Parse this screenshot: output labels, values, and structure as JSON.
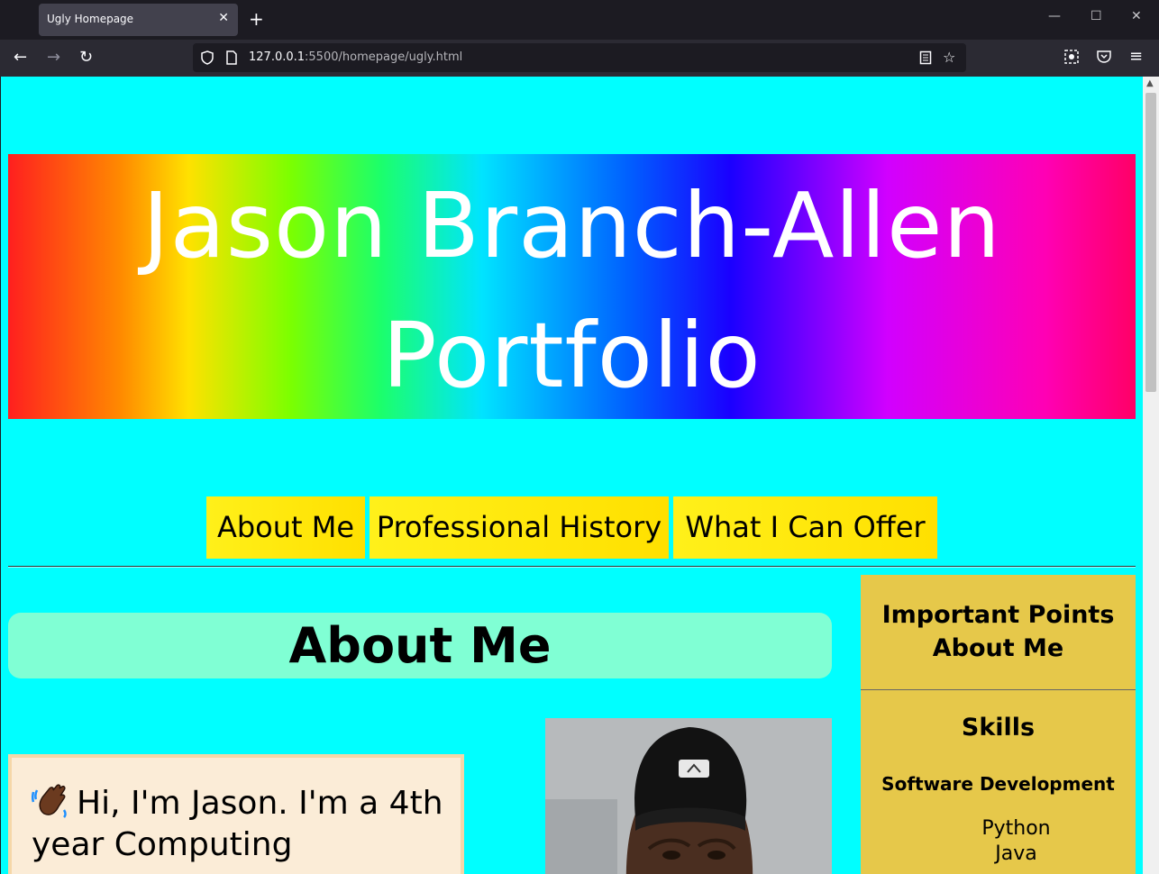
{
  "browser": {
    "tab_title": "Ugly Homepage",
    "url_host": "127.0.0.1",
    "url_rest": ":5500/homepage/ugly.html"
  },
  "hero": {
    "title": "Jason Branch-Allen Portfolio"
  },
  "nav": {
    "links": [
      "About Me",
      "Professional History",
      "What I Can Offer"
    ]
  },
  "main": {
    "heading": "About Me",
    "intro_text": "Hi, I'm Jason. I'm a 4th year Computing"
  },
  "aside": {
    "title": "Important Points About Me",
    "skills_heading": "Skills",
    "subheading": "Software Development",
    "skills": [
      "Python",
      "Java"
    ]
  },
  "colors": {
    "page_background": "#00ffff",
    "nav_link_bg": "#ffe000",
    "about_heading_bg": "#80ffd4",
    "aside_bg": "#e6c84a",
    "intro_box_bg": "#fbecd7"
  },
  "icons": [
    "back-icon",
    "forward-icon",
    "reload-icon",
    "shield-icon",
    "page-icon",
    "reader-view-icon",
    "bookmark-star-icon",
    "extension-icon",
    "pocket-icon",
    "menu-icon",
    "waving-hand-icon"
  ]
}
